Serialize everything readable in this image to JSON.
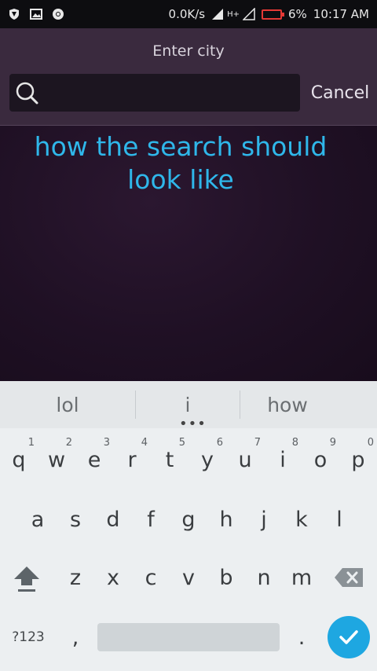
{
  "status_bar": {
    "left_icons": [
      "shield-icon",
      "image-icon",
      "chrome-icon"
    ],
    "net_speed": "0.0K/s",
    "signal_label": "H+",
    "battery_percent": "6%",
    "time": "10:17 AM",
    "battery_color": "#e53935"
  },
  "header": {
    "title": "Enter city",
    "search": {
      "value": "",
      "placeholder": ""
    },
    "cancel_label": "Cancel"
  },
  "annotation": {
    "text_line1": "how the search should",
    "text_line2": "look like",
    "color": "#2fb7ea"
  },
  "keyboard": {
    "suggestions": [
      "lol",
      "i",
      "how"
    ],
    "row1": [
      {
        "label": "q",
        "hint": "1"
      },
      {
        "label": "w",
        "hint": "2"
      },
      {
        "label": "e",
        "hint": "3"
      },
      {
        "label": "r",
        "hint": "4"
      },
      {
        "label": "t",
        "hint": "5"
      },
      {
        "label": "y",
        "hint": "6"
      },
      {
        "label": "u",
        "hint": "7"
      },
      {
        "label": "i",
        "hint": "8"
      },
      {
        "label": "o",
        "hint": "9"
      },
      {
        "label": "p",
        "hint": "0"
      }
    ],
    "row2": [
      "a",
      "s",
      "d",
      "f",
      "g",
      "h",
      "j",
      "k",
      "l"
    ],
    "row3": [
      "z",
      "x",
      "c",
      "v",
      "b",
      "n",
      "m"
    ],
    "symbols_label": "?123",
    "comma_label": ",",
    "period_label": ".",
    "enter_color": "#1ea7e1"
  }
}
